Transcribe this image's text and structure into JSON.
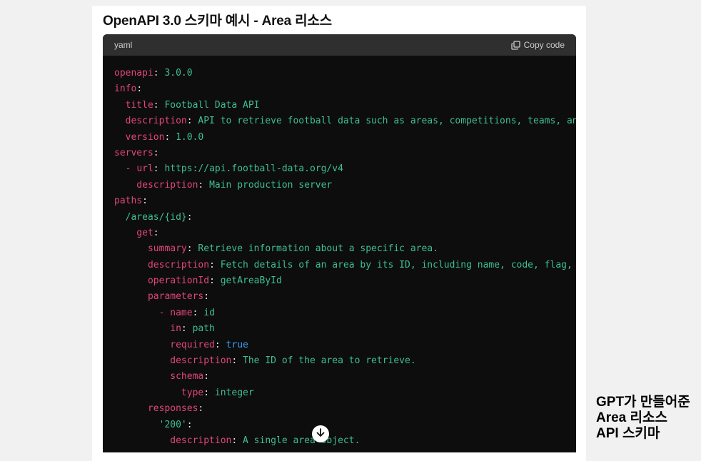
{
  "page": {
    "heading": "OpenAPI 3.0 스키마 예시 - Area 리소스",
    "caption_lines": [
      "GPT가 만들어준",
      "Area 리소스",
      "API 스키마"
    ]
  },
  "codeblock": {
    "language": "yaml",
    "copy_label": "Copy code",
    "copy_icon": "copy-icon",
    "scroll_icon": "arrow-down-icon",
    "colors": {
      "key": "#e2467a",
      "string": "#3fbf8f",
      "bool": "#3b9df5"
    },
    "lines": [
      [
        {
          "t": "openapi",
          "c": "k"
        },
        {
          "t": ": ",
          "c": "p"
        },
        {
          "t": "3.0.0",
          "c": "s"
        }
      ],
      [
        {
          "t": "info",
          "c": "k"
        },
        {
          "t": ":",
          "c": "p"
        }
      ],
      [
        {
          "t": "  title",
          "c": "k"
        },
        {
          "t": ": ",
          "c": "p"
        },
        {
          "t": "Football Data API",
          "c": "s"
        }
      ],
      [
        {
          "t": "  description",
          "c": "k"
        },
        {
          "t": ": ",
          "c": "p"
        },
        {
          "t": "API to retrieve football data such as areas, competitions, teams, an",
          "c": "s"
        }
      ],
      [
        {
          "t": "  version",
          "c": "k"
        },
        {
          "t": ": ",
          "c": "p"
        },
        {
          "t": "1.0.0",
          "c": "s"
        }
      ],
      [
        {
          "t": "servers",
          "c": "k"
        },
        {
          "t": ":",
          "c": "p"
        }
      ],
      [
        {
          "t": "  - ",
          "c": "k"
        },
        {
          "t": "url",
          "c": "k"
        },
        {
          "t": ": ",
          "c": "p"
        },
        {
          "t": "https://api.football-data.org/v4",
          "c": "s"
        }
      ],
      [
        {
          "t": "    description",
          "c": "k"
        },
        {
          "t": ": ",
          "c": "p"
        },
        {
          "t": "Main production server",
          "c": "s"
        }
      ],
      [
        {
          "t": "paths",
          "c": "k"
        },
        {
          "t": ":",
          "c": "p"
        }
      ],
      [
        {
          "t": "  /areas/{id}",
          "c": "s"
        },
        {
          "t": ":",
          "c": "p"
        }
      ],
      [
        {
          "t": "    get",
          "c": "k"
        },
        {
          "t": ":",
          "c": "p"
        }
      ],
      [
        {
          "t": "      summary",
          "c": "k"
        },
        {
          "t": ": ",
          "c": "p"
        },
        {
          "t": "Retrieve information about a specific area.",
          "c": "s"
        }
      ],
      [
        {
          "t": "      description",
          "c": "k"
        },
        {
          "t": ": ",
          "c": "p"
        },
        {
          "t": "Fetch details of an area by its ID, including name, code, flag, a",
          "c": "s"
        }
      ],
      [
        {
          "t": "      operationId",
          "c": "k"
        },
        {
          "t": ": ",
          "c": "p"
        },
        {
          "t": "getAreaById",
          "c": "s"
        }
      ],
      [
        {
          "t": "      parameters",
          "c": "k"
        },
        {
          "t": ":",
          "c": "p"
        }
      ],
      [
        {
          "t": "        - ",
          "c": "k"
        },
        {
          "t": "name",
          "c": "k"
        },
        {
          "t": ": ",
          "c": "p"
        },
        {
          "t": "id",
          "c": "s"
        }
      ],
      [
        {
          "t": "          in",
          "c": "k"
        },
        {
          "t": ": ",
          "c": "p"
        },
        {
          "t": "path",
          "c": "s"
        }
      ],
      [
        {
          "t": "          required",
          "c": "k"
        },
        {
          "t": ": ",
          "c": "p"
        },
        {
          "t": "true",
          "c": "b"
        }
      ],
      [
        {
          "t": "          description",
          "c": "k"
        },
        {
          "t": ": ",
          "c": "p"
        },
        {
          "t": "The ID of the area to retrieve.",
          "c": "s"
        }
      ],
      [
        {
          "t": "          schema",
          "c": "k"
        },
        {
          "t": ":",
          "c": "p"
        }
      ],
      [
        {
          "t": "            type",
          "c": "k"
        },
        {
          "t": ": ",
          "c": "p"
        },
        {
          "t": "integer",
          "c": "s"
        }
      ],
      [
        {
          "t": "      responses",
          "c": "k"
        },
        {
          "t": ":",
          "c": "p"
        }
      ],
      [
        {
          "t": "        '200'",
          "c": "s"
        },
        {
          "t": ":",
          "c": "p"
        }
      ],
      [
        {
          "t": "          description",
          "c": "k"
        },
        {
          "t": ": ",
          "c": "p"
        },
        {
          "t": "A single area object.",
          "c": "s"
        }
      ]
    ]
  }
}
